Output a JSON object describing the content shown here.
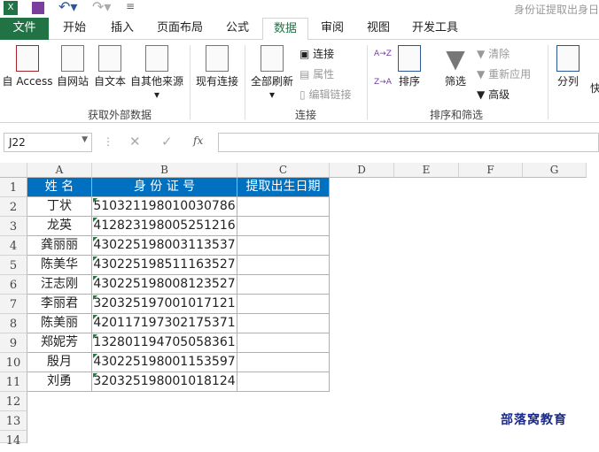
{
  "window": {
    "title": "身份证提取出身日"
  },
  "tabs": [
    "文件",
    "开始",
    "插入",
    "页面布局",
    "公式",
    "数据",
    "审阅",
    "视图",
    "开发工具"
  ],
  "ribbon": {
    "get_external": {
      "access": "自 Access",
      "web": "自网站",
      "text": "自文本",
      "other": "自其他来源",
      "existing": "现有连接",
      "group": "获取外部数据"
    },
    "connections": {
      "refresh_all": "全部刷新",
      "connections": "连接",
      "properties": "属性",
      "edit_links": "编辑链接",
      "group": "连接"
    },
    "sort_filter": {
      "az": "A→Z",
      "za": "Z→A",
      "sort": "排序",
      "filter": "筛选",
      "clear": "清除",
      "reapply": "重新应用",
      "advanced": "高级",
      "group": "排序和筛选"
    },
    "tools": {
      "text_to_columns": "分列",
      "flash": "快"
    }
  },
  "formula_bar": {
    "name_box": "J22",
    "fx": "fx",
    "formula": ""
  },
  "columns": [
    "A",
    "B",
    "C",
    "D",
    "E",
    "F",
    "G"
  ],
  "rows": [
    "1",
    "2",
    "3",
    "4",
    "5",
    "6",
    "7",
    "8",
    "9",
    "10",
    "11",
    "12",
    "13",
    "14"
  ],
  "table": {
    "headers": [
      "姓 名",
      "身 份 证 号",
      "提取出生日期"
    ],
    "rows": [
      [
        "丁状",
        "510321198010030786",
        ""
      ],
      [
        "龙英",
        "412823198005251216",
        ""
      ],
      [
        "龚丽丽",
        "430225198003113537",
        ""
      ],
      [
        "陈美华",
        "430225198511163527",
        ""
      ],
      [
        "汪志刚",
        "430225198008123527",
        ""
      ],
      [
        "李丽君",
        "320325197001017121",
        ""
      ],
      [
        "陈美丽",
        "420117197302175371",
        ""
      ],
      [
        "郑妮芳",
        "132801194705058361",
        ""
      ],
      [
        "殷月",
        "430225198001153597",
        ""
      ],
      [
        "刘勇",
        "320325198001018124",
        ""
      ]
    ]
  },
  "watermark": "部落窝教育"
}
